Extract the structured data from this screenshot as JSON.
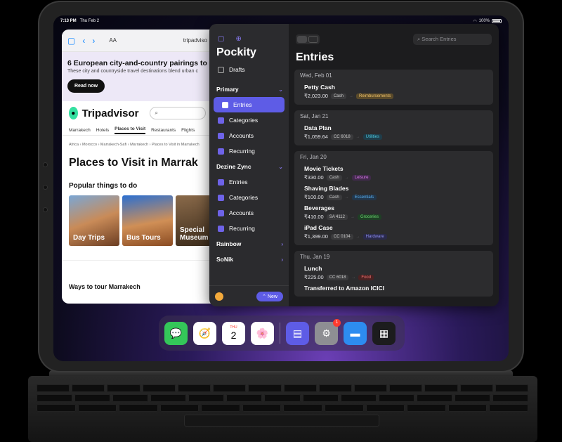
{
  "status_bar": {
    "time": "7:13 PM",
    "date": "Thu Feb 2",
    "battery": "100%"
  },
  "safari": {
    "text_size_label": "AA",
    "url": "tripadviso",
    "banner": {
      "title": "6 European city-and-country pairings to",
      "subtitle": "These city and countryside travel destinations blend urban c",
      "button": "Read now"
    },
    "brand": "Tripadvisor",
    "search_placeholder": "",
    "tabs": [
      "Marrakech",
      "Hotels",
      "Places to Visit",
      "Restaurants",
      "Flights"
    ],
    "active_tab": 2,
    "breadcrumb": "Africa › Morocco › Marrakech-Safi › Marrakech › Places to Visit in Marrakech",
    "page_title": "Places to Visit in Marrak",
    "section_title": "Popular things to do",
    "cards": [
      "Day Trips",
      "Bus Tours",
      "Special Museum"
    ],
    "ways_title": "Ways to tour Marrakech"
  },
  "pockity": {
    "app_title": "Pockity",
    "drafts_label": "Drafts",
    "accounts": [
      {
        "name": "Primary",
        "items": [
          "Entries",
          "Categories",
          "Accounts",
          "Recurring"
        ]
      },
      {
        "name": "Dezine Zync",
        "items": [
          "Entries",
          "Categories",
          "Accounts",
          "Recurring"
        ]
      }
    ],
    "collapsed_accounts": [
      "Rainbow",
      "SoNik"
    ],
    "new_button": "New",
    "main_title": "Entries",
    "search_placeholder": "Search Entries",
    "groups": [
      {
        "date": "Wed, Feb 01",
        "entries": [
          {
            "title": "Petty Cash",
            "amount": "₹2,023.00",
            "account": "Cash",
            "category": "Reimbursements",
            "cat_color": "#5a4a2a",
            "cat_text": "#f0c36a"
          }
        ]
      },
      {
        "date": "Sat, Jan 21",
        "entries": [
          {
            "title": "Data Plan",
            "amount": "₹1,059.64",
            "account": "CC 6018",
            "category": "Utilities",
            "cat_color": "#1f3d4a",
            "cat_text": "#4cc9e0"
          }
        ]
      },
      {
        "date": "Fri, Jan 20",
        "entries": [
          {
            "title": "Movie Tickets",
            "amount": "₹330.00",
            "account": "Cash",
            "category": "Leisure",
            "cat_color": "#402a4a",
            "cat_text": "#e07af0"
          },
          {
            "title": "Shaving Blades",
            "amount": "₹100.00",
            "account": "Cash",
            "category": "Essentials",
            "cat_color": "#22364a",
            "cat_text": "#5ab0f0"
          },
          {
            "title": "Beverages",
            "amount": "₹410.00",
            "account": "SA 4112",
            "category": "Groceries",
            "cat_color": "#1f3f25",
            "cat_text": "#6ad870"
          },
          {
            "title": "iPad Case",
            "amount": "₹1,399.00",
            "account": "CC 0104",
            "category": "Hardware",
            "cat_color": "#2a2a4a",
            "cat_text": "#8f8ff0"
          }
        ]
      },
      {
        "date": "Thu, Jan 19",
        "entries": [
          {
            "title": "Lunch",
            "amount": "₹225.00",
            "account": "CC 6018",
            "category": "Food",
            "cat_color": "#4a2222",
            "cat_text": "#f07070"
          },
          {
            "title": "Transferred to Amazon ICICI",
            "amount": "",
            "account": "",
            "category": "",
            "cat_color": "",
            "cat_text": ""
          }
        ]
      }
    ]
  },
  "dock": {
    "calendar_day": "THU",
    "calendar_date": "2",
    "settings_badge": "1"
  }
}
